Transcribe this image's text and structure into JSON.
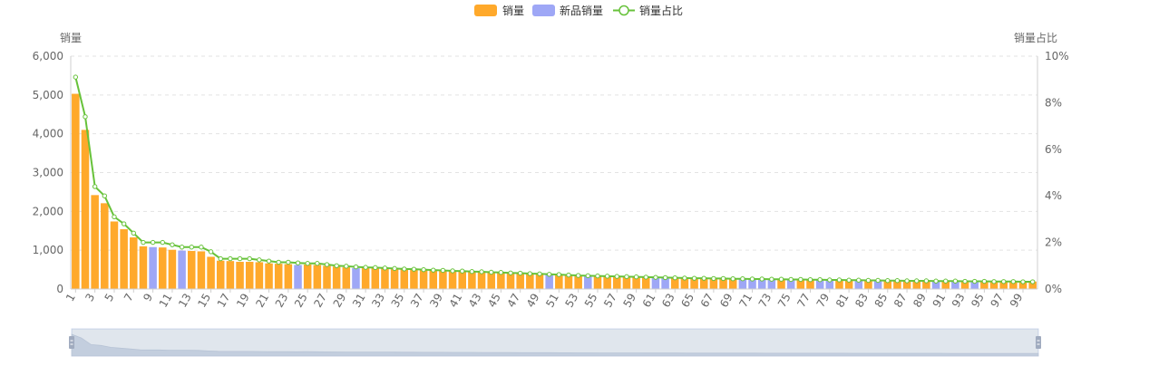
{
  "chart_data": {
    "type": "bar",
    "legend": {
      "position": "top-center",
      "items": [
        {
          "label": "销量",
          "color": "#ffa92b",
          "kind": "bar"
        },
        {
          "label": "新品销量",
          "color": "#9ea7f6",
          "kind": "bar"
        },
        {
          "label": "销量占比",
          "color": "#67c23a",
          "kind": "line"
        }
      ]
    },
    "y_left": {
      "label": "销量",
      "min": 0,
      "max": 6000,
      "ticks": [
        "0",
        "1,000",
        "2,000",
        "3,000",
        "4,000",
        "5,000",
        "6,000"
      ]
    },
    "y_right": {
      "label": "销量占比",
      "min": 0,
      "max": 10,
      "unit": "%",
      "ticks": [
        "0%",
        "2%",
        "4%",
        "6%",
        "8%",
        "10%"
      ]
    },
    "x_tick_labels": [
      "1",
      "3",
      "5",
      "7",
      "9",
      "11",
      "13",
      "15",
      "17",
      "19",
      "21",
      "23",
      "25",
      "27",
      "29",
      "31",
      "33",
      "35",
      "37",
      "39",
      "41",
      "43",
      "45",
      "47",
      "49",
      "51",
      "53",
      "55",
      "57",
      "59",
      "61",
      "63",
      "65",
      "67",
      "69",
      "71",
      "73",
      "75",
      "77",
      "79",
      "81",
      "83",
      "85",
      "87",
      "89",
      "91",
      "93",
      "95",
      "97",
      "99"
    ],
    "grid": {
      "horizontal_dashed": true
    },
    "categories": [
      1,
      2,
      3,
      4,
      5,
      6,
      7,
      8,
      9,
      10,
      11,
      12,
      13,
      14,
      15,
      16,
      17,
      18,
      19,
      20,
      21,
      22,
      23,
      24,
      25,
      26,
      27,
      28,
      29,
      30,
      31,
      32,
      33,
      34,
      35,
      36,
      37,
      38,
      39,
      40,
      41,
      42,
      43,
      44,
      45,
      46,
      47,
      48,
      49,
      50,
      51,
      52,
      53,
      54,
      55,
      56,
      57,
      58,
      59,
      60,
      61,
      62,
      63,
      64,
      65,
      66,
      67,
      68,
      69,
      70,
      71,
      72,
      73,
      74,
      75,
      76,
      77,
      78,
      79,
      80,
      81,
      82,
      83,
      84,
      85,
      86,
      87,
      88,
      89,
      90,
      91,
      92,
      93,
      94,
      95,
      96,
      97,
      98,
      99,
      100
    ],
    "sales": [
      5030,
      4100,
      2420,
      2210,
      1740,
      1540,
      1330,
      1100,
      1080,
      1070,
      1010,
      990,
      980,
      970,
      830,
      730,
      720,
      700,
      700,
      690,
      660,
      650,
      640,
      620,
      630,
      620,
      600,
      580,
      560,
      540,
      550,
      550,
      540,
      520,
      510,
      500,
      490,
      480,
      470,
      460,
      460,
      450,
      440,
      430,
      420,
      410,
      400,
      390,
      390,
      380,
      370,
      360,
      350,
      340,
      330,
      325,
      320,
      315,
      310,
      305,
      300,
      295,
      290,
      285,
      280,
      278,
      275,
      272,
      270,
      268,
      265,
      262,
      260,
      258,
      255,
      252,
      250,
      248,
      245,
      242,
      240,
      238,
      235,
      232,
      230,
      228,
      225,
      222,
      220,
      218,
      215,
      212,
      210,
      208,
      205,
      202,
      200,
      198,
      195,
      192
    ],
    "new_product_flags": [
      9,
      12,
      24,
      30,
      50,
      54,
      61,
      62,
      70,
      71,
      72,
      73,
      75,
      78,
      79,
      82,
      84,
      90,
      92,
      94
    ],
    "share_percent": [
      9.1,
      7.4,
      4.4,
      4.0,
      3.1,
      2.8,
      2.4,
      2.0,
      2.0,
      2.0,
      1.9,
      1.8,
      1.8,
      1.8,
      1.6,
      1.3,
      1.3,
      1.3,
      1.3,
      1.25,
      1.2,
      1.15,
      1.15,
      1.12,
      1.1,
      1.1,
      1.05,
      1.0,
      0.98,
      0.95,
      0.93,
      0.92,
      0.9,
      0.88,
      0.86,
      0.85,
      0.83,
      0.81,
      0.8,
      0.78,
      0.77,
      0.75,
      0.74,
      0.72,
      0.71,
      0.69,
      0.68,
      0.66,
      0.65,
      0.63,
      0.62,
      0.6,
      0.58,
      0.57,
      0.56,
      0.55,
      0.54,
      0.53,
      0.52,
      0.51,
      0.5,
      0.49,
      0.48,
      0.47,
      0.46,
      0.46,
      0.45,
      0.45,
      0.44,
      0.44,
      0.43,
      0.43,
      0.42,
      0.42,
      0.41,
      0.41,
      0.4,
      0.4,
      0.39,
      0.39,
      0.38,
      0.38,
      0.37,
      0.37,
      0.36,
      0.36,
      0.35,
      0.35,
      0.35,
      0.34,
      0.34,
      0.34,
      0.33,
      0.33,
      0.33,
      0.32,
      0.32,
      0.32,
      0.31,
      0.31
    ],
    "data_zoom": {
      "start_percent": 0,
      "end_percent": 100
    }
  }
}
